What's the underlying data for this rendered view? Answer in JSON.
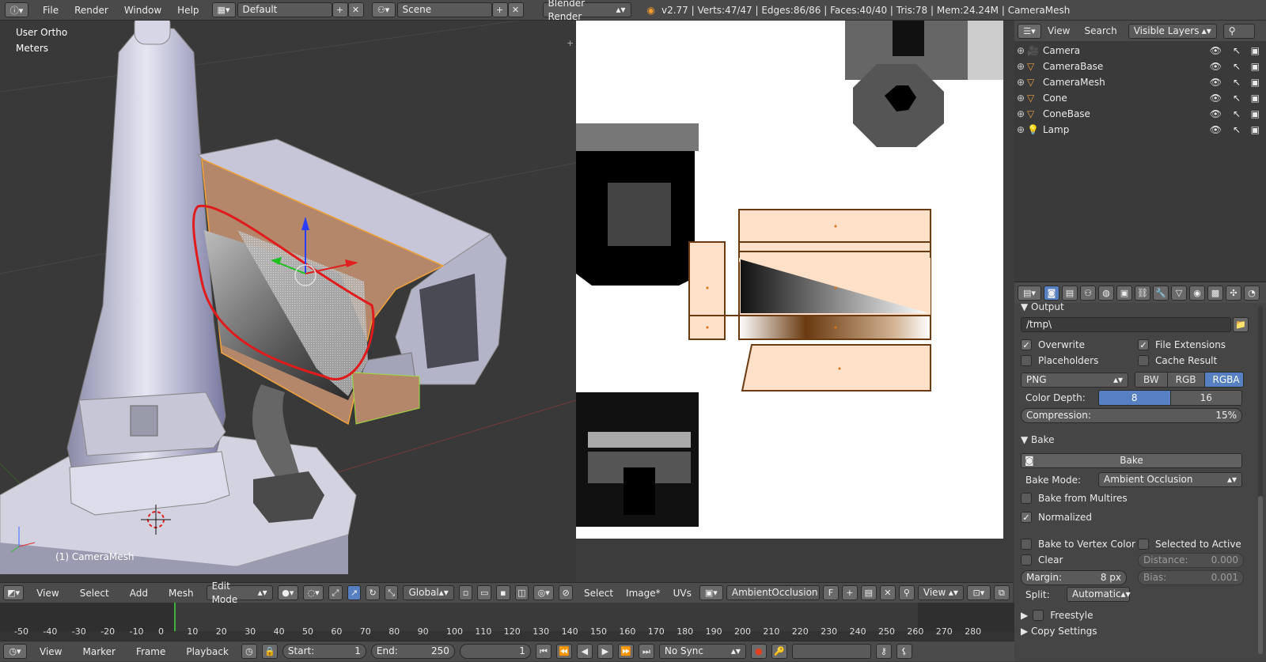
{
  "topbar": {
    "menus": [
      "File",
      "Render",
      "Window",
      "Help"
    ],
    "screen_layout": "Default",
    "scene": "Scene",
    "engine": "Blender Render",
    "stats": "v2.77 | Verts:47/47 | Edges:86/86 | Faces:40/40 | Tris:78 | Mem:24.24M | CameraMesh"
  },
  "viewport3d": {
    "view_name": "User Ortho",
    "units": "Meters",
    "object_label": "(1) CameraMesh",
    "header": {
      "menus": [
        "View",
        "Select",
        "Add",
        "Mesh"
      ],
      "mode": "Edit Mode",
      "orientation": "Global"
    }
  },
  "uv_editor": {
    "header": {
      "menus": [
        "Select",
        "Image*",
        "UVs"
      ],
      "image_name": "AmbientOcclusion",
      "fake_user": "F",
      "view": "View"
    }
  },
  "outliner": {
    "header": {
      "view": "View",
      "search": "Search",
      "filter": "Visible Layers"
    },
    "items": [
      {
        "name": "Camera",
        "icon": "camera-object-icon"
      },
      {
        "name": "CameraBase",
        "icon": "mesh-object-icon"
      },
      {
        "name": "CameraMesh",
        "icon": "mesh-object-icon"
      },
      {
        "name": "Cone",
        "icon": "mesh-object-icon"
      },
      {
        "name": "ConeBase",
        "icon": "mesh-object-icon"
      },
      {
        "name": "Lamp",
        "icon": "lamp-object-icon"
      }
    ]
  },
  "properties": {
    "output_title": "Output",
    "output_path": "/tmp\\",
    "overwrite": "Overwrite",
    "file_extensions": "File Extensions",
    "placeholders": "Placeholders",
    "cache_result": "Cache Result",
    "format": "PNG",
    "color_modes": [
      "BW",
      "RGB",
      "RGBA"
    ],
    "color_depth_label": "Color Depth:",
    "color_depths": [
      "8",
      "16"
    ],
    "compression_label": "Compression:",
    "compression_value": "15%",
    "bake_title": "Bake",
    "bake_button": "Bake",
    "bake_mode_label": "Bake Mode:",
    "bake_mode": "Ambient Occlusion",
    "bake_from_multires": "Bake from Multires",
    "normalized": "Normalized",
    "bake_to_vertex": "Bake to Vertex Color",
    "selected_to_active": "Selected to Active",
    "clear": "Clear",
    "distance_label": "Distance:",
    "distance_value": "0.000",
    "margin_label": "Margin:",
    "margin_value": "8 px",
    "bias_label": "Bias:",
    "bias_value": "0.001",
    "split_label": "Split:",
    "split_value": "Automatic",
    "freestyle": "Freestyle",
    "copy_settings": "Copy Settings"
  },
  "timeline": {
    "ticks": [
      "-50",
      "-40",
      "-30",
      "-20",
      "-10",
      "0",
      "10",
      "20",
      "30",
      "40",
      "50",
      "60",
      "70",
      "80",
      "90",
      "100",
      "110",
      "120",
      "130",
      "140",
      "150",
      "160",
      "170",
      "180",
      "190",
      "200",
      "210",
      "220",
      "230",
      "240",
      "250",
      "260",
      "270",
      "280"
    ],
    "menus": [
      "View",
      "Marker",
      "Frame",
      "Playback"
    ],
    "start_label": "Start:",
    "start_value": "1",
    "end_label": "End:",
    "end_value": "250",
    "current_frame": "1",
    "sync": "No Sync"
  }
}
